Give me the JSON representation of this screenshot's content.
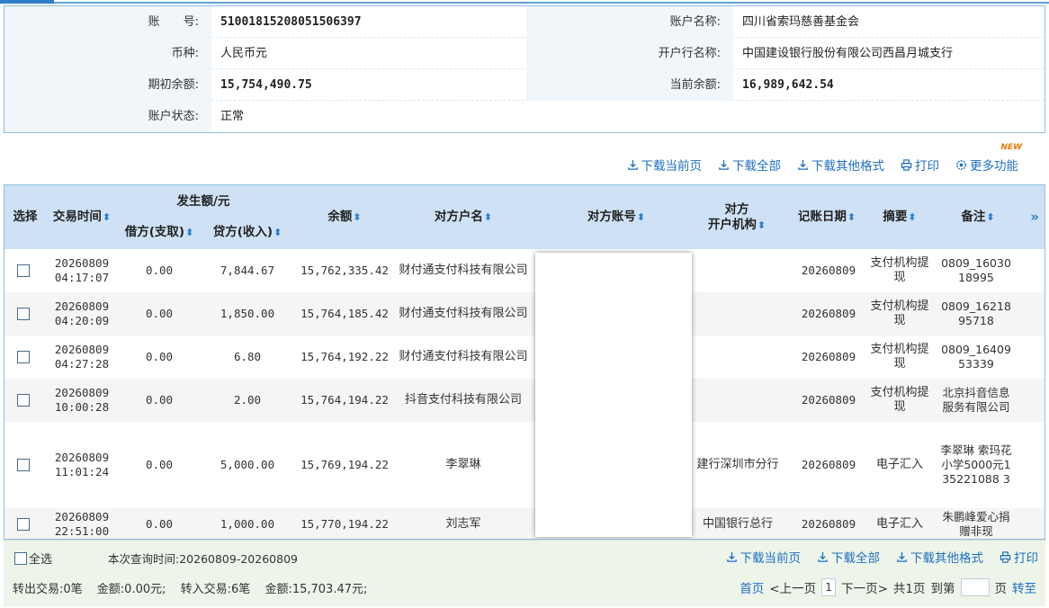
{
  "account": {
    "account_no_label": "账　　号:",
    "account_no": "51001815208051506397",
    "account_name_label": "账户名称:",
    "account_name": "四川省索玛慈善基金会",
    "currency_label": "币种:",
    "currency": "人民币元",
    "bank_label": "开户行名称:",
    "bank": "中国建设银行股份有限公司西昌月城支行",
    "opening_balance_label": "期初余额:",
    "opening_balance": "15,754,490.75",
    "current_balance_label": "当前余额:",
    "current_balance": "16,989,642.54",
    "status_label": "账户状态:",
    "status": "正常"
  },
  "toolbar": {
    "download_current": "下载当前页",
    "download_all": "下载全部",
    "download_other": "下载其他格式",
    "print": "打印",
    "more": "更多功能",
    "new_badge": "NEW"
  },
  "table": {
    "headers": {
      "select": "选择",
      "time": "交易时间",
      "amount_group": "发生额/元",
      "debit": "借方(支取)",
      "credit": "贷方(收入)",
      "balance": "余额",
      "counterparty_name": "对方户名",
      "counterparty_account": "对方账号",
      "counterparty_bank_1": "对方",
      "counterparty_bank_2": "开户机构",
      "post_date": "记账日期",
      "summary": "摘要",
      "remark": "备注"
    },
    "rows": [
      {
        "date": "20260809",
        "time": "04:17:07",
        "debit": "0.00",
        "credit": "7,844.67",
        "balance": "15,762,335.42",
        "name": "财付通支付科技有限公司",
        "bank": "",
        "post_date": "20260809",
        "summary": "支付机构提现",
        "remark": "0809_1603018995"
      },
      {
        "date": "20260809",
        "time": "04:20:09",
        "debit": "0.00",
        "credit": "1,850.00",
        "balance": "15,764,185.42",
        "name": "财付通支付科技有限公司",
        "bank": "",
        "post_date": "20260809",
        "summary": "支付机构提现",
        "remark": "0809_1621895718"
      },
      {
        "date": "20260809",
        "time": "04:27:28",
        "debit": "0.00",
        "credit": "6.80",
        "balance": "15,764,192.22",
        "name": "财付通支付科技有限公司",
        "bank": "",
        "post_date": "20260809",
        "summary": "支付机构提现",
        "remark": "0809_1640953339"
      },
      {
        "date": "20260809",
        "time": "10:00:28",
        "debit": "0.00",
        "credit": "2.00",
        "balance": "15,764,194.22",
        "name": "抖音支付科技有限公司",
        "bank": "",
        "post_date": "20260809",
        "summary": "支付机构提现",
        "remark": "北京抖音信息服务有限公司"
      },
      {
        "date": "20260809",
        "time": "11:01:24",
        "debit": "0.00",
        "credit": "5,000.00",
        "balance": "15,769,194.22",
        "name": "李翠琳",
        "bank": "建行深圳市分行",
        "post_date": "20260809",
        "summary": "电子汇入",
        "remark": "李翠琳 索玛花小学5000元135221088 3"
      },
      {
        "date": "20260809",
        "time": "22:51:00",
        "debit": "0.00",
        "credit": "1,000.00",
        "balance": "15,770,194.22",
        "name": "刘志军",
        "bank": "中国银行总行",
        "post_date": "20260809",
        "summary": "电子汇入",
        "remark": "朱鹏峰爱心捐赠非现"
      }
    ]
  },
  "footer": {
    "select_all": "全选",
    "query_time": "本次查询时间:20260809-20260809",
    "out_count": "转出交易:0笔",
    "out_amount": "金额:0.00元;",
    "in_count": "转入交易:6笔",
    "in_amount": "金额:15,703.47元;",
    "first": "首页",
    "prev": "<上一页",
    "page_no": "1",
    "next": "下一页>",
    "total": "共1页",
    "goto": "到第",
    "page_unit": "页",
    "go": "转至"
  }
}
